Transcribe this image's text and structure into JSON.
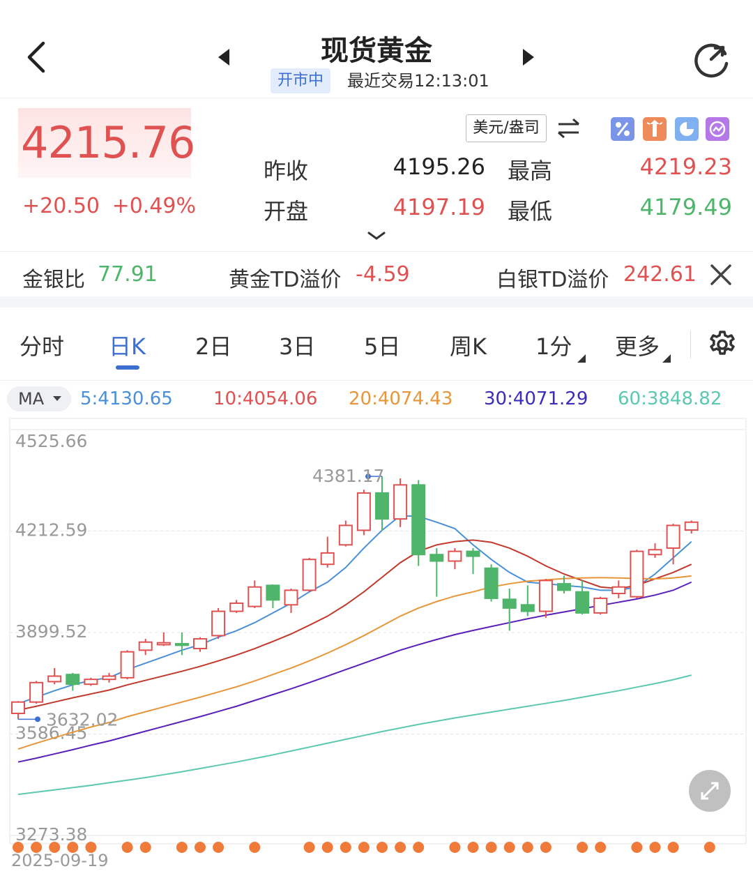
{
  "header": {
    "title": "现货黄金",
    "status": "开市中",
    "last_trade": "最近交易12:13:01"
  },
  "quote": {
    "price": "4215.76",
    "change": "+20.50",
    "change_pct": "+0.49%",
    "unit": "美元/盎司",
    "prev_close_label": "昨收",
    "prev_close": "4195.26",
    "open_label": "开盘",
    "open": "4197.19",
    "high_label": "最高",
    "high": "4219.23",
    "low_label": "最低",
    "low": "4179.49"
  },
  "ratios": {
    "gold_silver_label": "金银比",
    "gold_silver": "77.91",
    "gold_td_label": "黄金TD溢价",
    "gold_td": "-4.59",
    "silver_td_label": "白银TD溢价",
    "silver_td": "242.61"
  },
  "tabs": [
    "分时",
    "日K",
    "2日",
    "3日",
    "5日",
    "周K",
    "1分",
    "更多"
  ],
  "active_tab": "日K",
  "ma": {
    "selector": "MA",
    "items": [
      {
        "label": "5:4130.65",
        "color": "#4a90d9"
      },
      {
        "label": "10:4054.06",
        "color": "#e05151"
      },
      {
        "label": "20:4074.43",
        "color": "#e8963a"
      },
      {
        "label": "30:4071.29",
        "color": "#3a2db8"
      },
      {
        "label": "60:3848.82",
        "color": "#5cc8b0"
      }
    ]
  },
  "colors": {
    "up": "#e05151",
    "down": "#4fb56a",
    "accent": "#3c6fd0",
    "ma5": "#4a90d9",
    "ma10": "#c0392b",
    "ma20": "#e8963a",
    "ma30": "#5a1fb8",
    "ma60": "#5cc8b0",
    "event_dot": "#f07a3a"
  },
  "chart_data": {
    "type": "candlestick",
    "y_ticks": [
      "4525.66",
      "4212.59",
      "3899.52",
      "3586.45",
      "3273.38"
    ],
    "ylim": [
      3273.38,
      4525.66
    ],
    "x_start_label": "2025-09-19",
    "max_label": "4381.17",
    "min_label": "3632.02",
    "candles": [
      {
        "o": 3650,
        "c": 3685,
        "h": 3688,
        "l": 3632.02
      },
      {
        "o": 3685,
        "c": 3745,
        "h": 3750,
        "l": 3680
      },
      {
        "o": 3748,
        "c": 3765,
        "h": 3790,
        "l": 3740
      },
      {
        "o": 3770,
        "c": 3740,
        "h": 3775,
        "l": 3720
      },
      {
        "o": 3740,
        "c": 3755,
        "h": 3760,
        "l": 3735
      },
      {
        "o": 3755,
        "c": 3765,
        "h": 3775,
        "l": 3745
      },
      {
        "o": 3760,
        "c": 3840,
        "h": 3845,
        "l": 3755
      },
      {
        "o": 3845,
        "c": 3870,
        "h": 3880,
        "l": 3830
      },
      {
        "o": 3862,
        "c": 3868,
        "h": 3900,
        "l": 3858
      },
      {
        "o": 3865,
        "c": 3860,
        "h": 3900,
        "l": 3830
      },
      {
        "o": 3850,
        "c": 3880,
        "h": 3885,
        "l": 3840
      },
      {
        "o": 3890,
        "c": 3965,
        "h": 3975,
        "l": 3880
      },
      {
        "o": 3965,
        "c": 3990,
        "h": 4000,
        "l": 3960
      },
      {
        "o": 3980,
        "c": 4040,
        "h": 4060,
        "l": 3975
      },
      {
        "o": 4045,
        "c": 4000,
        "h": 4048,
        "l": 3975
      },
      {
        "o": 3985,
        "c": 4030,
        "h": 4035,
        "l": 3960
      },
      {
        "o": 4030,
        "c": 4125,
        "h": 4130,
        "l": 4025
      },
      {
        "o": 4110,
        "c": 4145,
        "h": 4195,
        "l": 4100
      },
      {
        "o": 4170,
        "c": 4230,
        "h": 4245,
        "l": 4165
      },
      {
        "o": 4215,
        "c": 4330,
        "h": 4340,
        "l": 4200
      },
      {
        "o": 4330,
        "c": 4250,
        "h": 4381.17,
        "l": 4215
      },
      {
        "o": 4250,
        "c": 4355,
        "h": 4375,
        "l": 4225
      },
      {
        "o": 4355,
        "c": 4140,
        "h": 4370,
        "l": 4105
      },
      {
        "o": 4140,
        "c": 4120,
        "h": 4160,
        "l": 4010
      },
      {
        "o": 4120,
        "c": 4150,
        "h": 4160,
        "l": 4095
      },
      {
        "o": 4150,
        "c": 4135,
        "h": 4160,
        "l": 4080
      },
      {
        "o": 4098,
        "c": 4005,
        "h": 4110,
        "l": 3995
      },
      {
        "o": 4002,
        "c": 3975,
        "h": 4035,
        "l": 3905
      },
      {
        "o": 3985,
        "c": 3965,
        "h": 4045,
        "l": 3950
      },
      {
        "o": 3965,
        "c": 4060,
        "h": 4065,
        "l": 3945
      },
      {
        "o": 4050,
        "c": 4030,
        "h": 4075,
        "l": 4020
      },
      {
        "o": 4025,
        "c": 3960,
        "h": 4060,
        "l": 3955
      },
      {
        "o": 3960,
        "c": 4005,
        "h": 4010,
        "l": 3955
      },
      {
        "o": 4020,
        "c": 4040,
        "h": 4060,
        "l": 4005
      },
      {
        "o": 4010,
        "c": 4150,
        "h": 4155,
        "l": 4005
      },
      {
        "o": 4140,
        "c": 4155,
        "h": 4175,
        "l": 4130
      },
      {
        "o": 4160,
        "c": 4230,
        "h": 4235,
        "l": 4110
      },
      {
        "o": 4215.76,
        "c": 4240,
        "h": 4245,
        "l": 4205
      }
    ],
    "ma_series": [
      {
        "name": "MA5",
        "values": [
          3680,
          3700,
          3720,
          3738,
          3752,
          3760,
          3785,
          3805,
          3825,
          3845,
          3862,
          3885,
          3905,
          3930,
          3960,
          3990,
          4025,
          4055,
          4100,
          4160,
          4215,
          4260,
          4258,
          4240,
          4220,
          4170,
          4125,
          4085,
          4055,
          4050,
          4045,
          4040,
          4030,
          4030,
          4040,
          4080,
          4130,
          4180
        ]
      },
      {
        "name": "MA10",
        "values": [
          3660,
          3672,
          3685,
          3698,
          3710,
          3722,
          3738,
          3752,
          3766,
          3780,
          3795,
          3812,
          3830,
          3850,
          3872,
          3895,
          3922,
          3950,
          3985,
          4025,
          4070,
          4115,
          4150,
          4170,
          4180,
          4185,
          4178,
          4160,
          4135,
          4105,
          4080,
          4060,
          4040,
          4035,
          4045,
          4065,
          4085,
          4110
        ]
      },
      {
        "name": "MA20",
        "values": [
          3540,
          3558,
          3575,
          3592,
          3608,
          3622,
          3640,
          3655,
          3670,
          3685,
          3700,
          3716,
          3732,
          3750,
          3770,
          3790,
          3812,
          3836,
          3862,
          3890,
          3920,
          3950,
          3975,
          3995,
          4012,
          4025,
          4040,
          4050,
          4058,
          4062,
          4066,
          4068,
          4069,
          4068,
          4066,
          4065,
          4068,
          4074
        ]
      },
      {
        "name": "MA30",
        "values": [
          3500,
          3512,
          3525,
          3538,
          3552,
          3565,
          3580,
          3595,
          3610,
          3625,
          3640,
          3656,
          3672,
          3690,
          3708,
          3726,
          3745,
          3765,
          3785,
          3805,
          3825,
          3845,
          3862,
          3878,
          3893,
          3906,
          3918,
          3930,
          3942,
          3953,
          3963,
          3973,
          3983,
          3993,
          4003,
          4015,
          4030,
          4055
        ]
      },
      {
        "name": "MA60",
        "values": [
          3400,
          3407,
          3414,
          3421,
          3428,
          3436,
          3444,
          3452,
          3461,
          3470,
          3480,
          3490,
          3500,
          3511,
          3522,
          3534,
          3546,
          3558,
          3570,
          3582,
          3594,
          3605,
          3616,
          3626,
          3636,
          3645,
          3654,
          3663,
          3672,
          3681,
          3690,
          3700,
          3710,
          3720,
          3731,
          3742,
          3754,
          3768
        ]
      }
    ]
  }
}
